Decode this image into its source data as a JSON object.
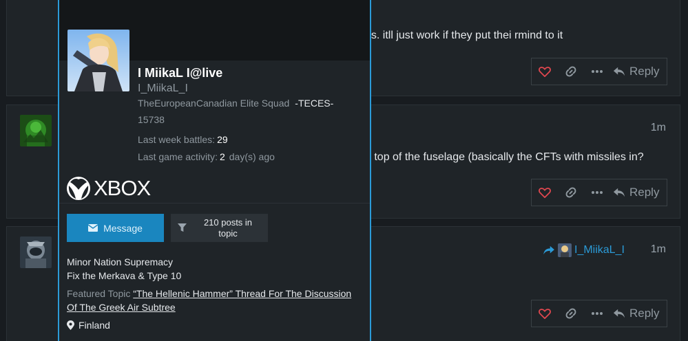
{
  "posts": [
    {
      "text": "es. itll just work if they put thei rmind to it",
      "reply_label": "Reply"
    },
    {
      "time": "1m",
      "text": "e top of the fuselage (basically the CFTs with missiles in?",
      "reply_label": "Reply"
    },
    {
      "time": "1m",
      "reply_to_user": "I_MiikaL_I",
      "reply_label": "Reply"
    }
  ],
  "card": {
    "display_name": "I MiikaL I@live",
    "username": "I_MiikaL_I",
    "squad_name": "TheEuropeanCanadian Elite Squad",
    "squad_tag": "-TECES-",
    "user_id": "15738",
    "stats": {
      "battles_label": "Last week battles",
      "battles_value": "29",
      "activity_label": "Last game activity",
      "activity_value": "2",
      "activity_unit": "day(s) ago"
    },
    "platform": "XBOX",
    "message_label": "Message",
    "posts_in_topic_label": "210 posts in topic",
    "title_1": "Minor Nation Supremacy",
    "title_2": "Fix the Merkava & Type 10",
    "featured_label": "Featured Topic",
    "featured_topic": "“The Hellenic Hammer” Thread For The Discussion Of The Greek Air Subtree",
    "location": "Finland"
  },
  "colors": {
    "accent": "#2b9bd8",
    "like": "#e0474f",
    "message_button": "#1a86bf"
  }
}
